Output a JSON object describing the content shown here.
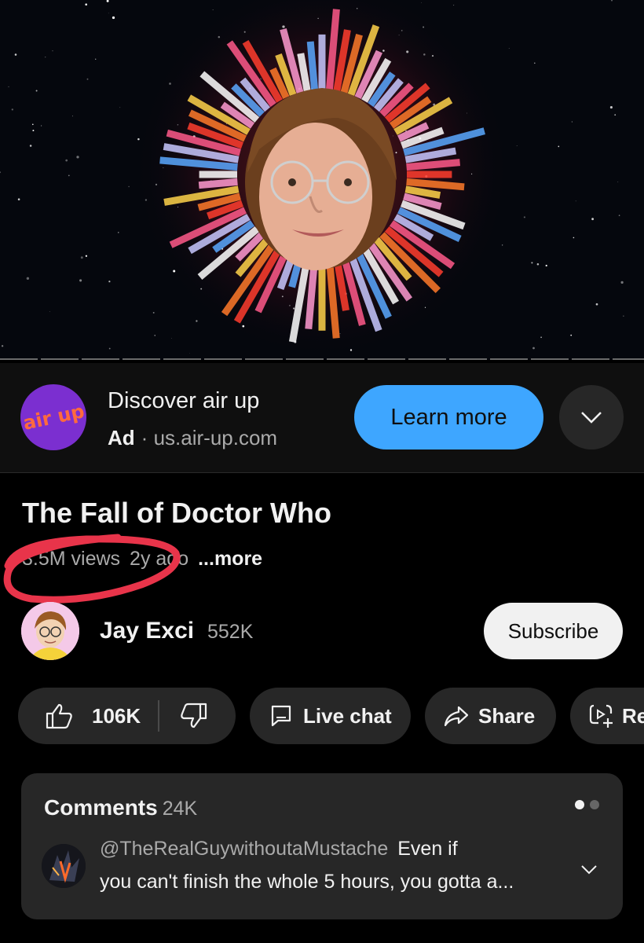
{
  "video": {
    "thumbnail_icon": "visualizer-face-icon"
  },
  "ad": {
    "logo_text": "air up",
    "title": "Discover air up",
    "label": "Ad",
    "separator": "·",
    "domain": "us.air-up.com",
    "cta": "Learn more",
    "expand_icon": "chevron-down-icon"
  },
  "video_info": {
    "title": "The Fall of Doctor Who",
    "views": "3.5M views",
    "age": "2y ago",
    "more": "...more"
  },
  "channel": {
    "name": "Jay Exci",
    "subscribers": "552K",
    "subscribe_label": "Subscribe"
  },
  "actions": {
    "likes": "106K",
    "live_chat": "Live chat",
    "share": "Share",
    "remix": "Re"
  },
  "comments": {
    "label": "Comments",
    "count": "24K",
    "top_comment": {
      "handle": "@TheRealGuywithoutaMustache",
      "text_line1": "Even if",
      "text_line2": "you can't finish the whole 5 hours, you gotta a..."
    }
  },
  "colors": {
    "accent": "#3ea6ff",
    "background": "#000000",
    "surface": "#272727",
    "annotation": "#e8344a"
  }
}
